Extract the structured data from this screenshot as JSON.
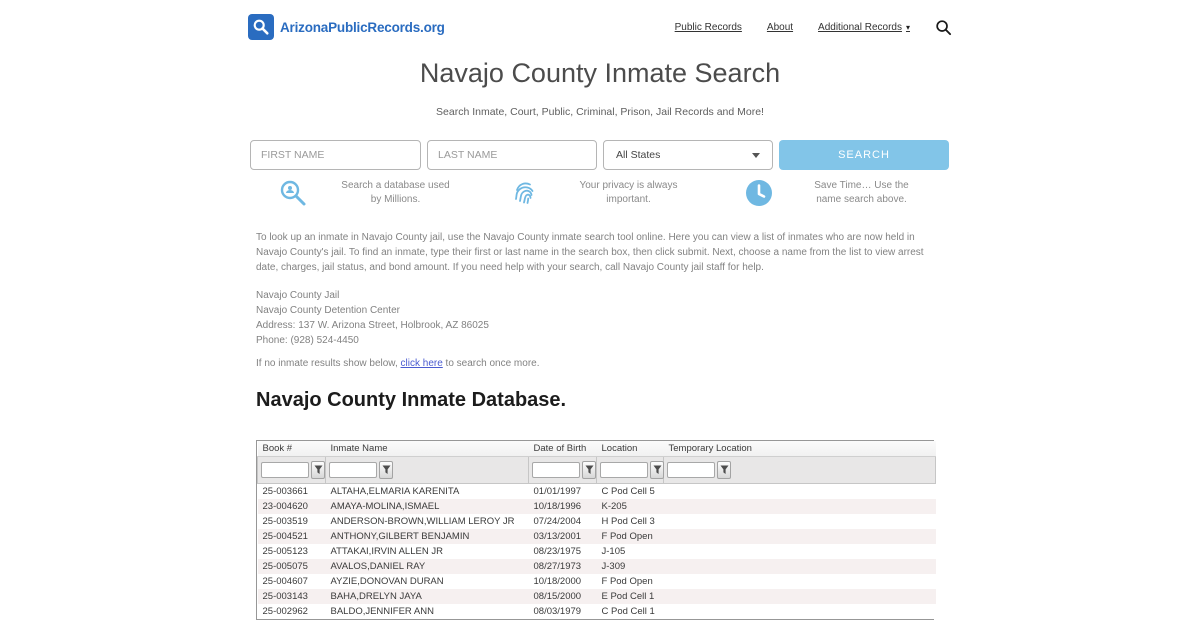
{
  "brand": {
    "name": "ArizonaPublicRecords.org",
    "logo_icon": "magnifier-icon",
    "color": "#2a6cc0"
  },
  "nav": {
    "items": [
      {
        "label": "Public Records"
      },
      {
        "label": "About"
      },
      {
        "label": "Additional Records",
        "has_dropdown": true,
        "caret_icon": "caret-down-icon"
      }
    ],
    "search_icon": "search-icon"
  },
  "hero": {
    "title": "Navajo County Inmate Search",
    "subtitle": "Search Inmate, Court, Public, Criminal, Prison, Jail Records and More!",
    "form": {
      "first_name_placeholder": "FIRST NAME",
      "last_name_placeholder": "LAST NAME",
      "state_selected": "All States",
      "state_caret_icon": "chevron-down-icon",
      "search_label": "SEARCH",
      "button_color": "#82c5e8"
    },
    "features": [
      {
        "icon": "database-search-icon",
        "line1": "Search a database used",
        "line2": "by Millions."
      },
      {
        "icon": "fingerprint-icon",
        "line1": "Your privacy is always",
        "line2": "important."
      },
      {
        "icon": "clock-icon",
        "line1": "Save Time… Use the",
        "line2": "name search above."
      }
    ],
    "feature_icon_color": "#6fb8e2"
  },
  "intro_paragraph": "To look up an inmate in Navajo County jail, use the Navajo County inmate search tool online. Here you can view a list of inmates who are now held in Navajo County's jail. To find an inmate, type their first or last name in the search box, then click submit. Next, choose a name from the list to view arrest date, charges, jail status, and bond amount. If you need help with your search, call Navajo County jail staff for help.",
  "facility": {
    "lines": [
      "Navajo County Jail",
      "Navajo County Detention Center",
      "Address: 137 W. Arizona Street, Holbrook, AZ 86025",
      "Phone: (928) 524-4450"
    ]
  },
  "retry": {
    "prefix": "If no inmate results show below, ",
    "link": "click here",
    "suffix": " to search once more.",
    "link_color": "#4a5bd0"
  },
  "database": {
    "heading": "Navajo County Inmate Database.",
    "columns": [
      "Book #",
      "Inmate Name",
      "Date of Birth",
      "Location",
      "Temporary Location"
    ],
    "filter_icon": "funnel-icon",
    "stripe_color": "#f6f0f0",
    "rows": [
      {
        "book": "25-003661",
        "name": "ALTAHA,ELMARIA KARENITA",
        "dob": "01/01/1997",
        "location": "C Pod Cell 5",
        "temp": ""
      },
      {
        "book": "23-004620",
        "name": "AMAYA-MOLINA,ISMAEL",
        "dob": "10/18/1996",
        "location": "K-205",
        "temp": ""
      },
      {
        "book": "25-003519",
        "name": "ANDERSON-BROWN,WILLIAM LEROY JR",
        "dob": "07/24/2004",
        "location": "H Pod Cell 3",
        "temp": ""
      },
      {
        "book": "25-004521",
        "name": "ANTHONY,GILBERT BENJAMIN",
        "dob": "03/13/2001",
        "location": "F Pod Open",
        "temp": ""
      },
      {
        "book": "25-005123",
        "name": "ATTAKAI,IRVIN ALLEN JR",
        "dob": "08/23/1975",
        "location": "J-105",
        "temp": ""
      },
      {
        "book": "25-005075",
        "name": "AVALOS,DANIEL RAY",
        "dob": "08/27/1973",
        "location": "J-309",
        "temp": ""
      },
      {
        "book": "25-004607",
        "name": "AYZIE,DONOVAN DURAN",
        "dob": "10/18/2000",
        "location": "F Pod Open",
        "temp": ""
      },
      {
        "book": "25-003143",
        "name": "BAHA,DRELYN JAYA",
        "dob": "08/15/2000",
        "location": "E Pod Cell 1",
        "temp": ""
      },
      {
        "book": "25-002962",
        "name": "BALDO,JENNIFER ANN",
        "dob": "08/03/1979",
        "location": "C Pod Cell 1",
        "temp": ""
      }
    ]
  }
}
